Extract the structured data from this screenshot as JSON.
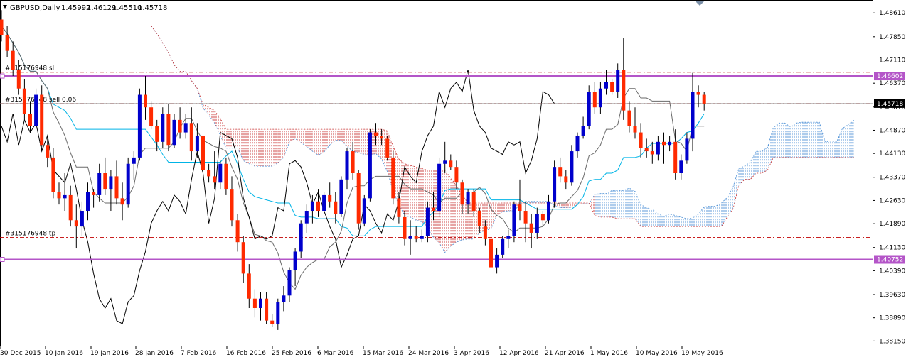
{
  "header": {
    "symbol": "GBPUSD,Daily",
    "open": "1.45992",
    "high": "1.46129",
    "low": "1.45510",
    "close": "1.45718"
  },
  "colors": {
    "up": "#0000cc",
    "down": "#ff2a00",
    "wick": "#000000",
    "tenkan": "#6a6a6a",
    "kijun": "#00b4e6",
    "chikou": "#000000",
    "cloud_bear": "#c83232",
    "cloud_bull": "#4a8fd6",
    "order_line": "#c00000",
    "resistance": "#b455c8",
    "price_line": "#888888"
  },
  "orders": [
    {
      "label": "#315176948 sl",
      "price": 1.4672
    },
    {
      "label": "#315176948 sell 0.06",
      "price": 1.4572
    },
    {
      "label": "#315176948 tp",
      "price": 1.4145
    }
  ],
  "badges": [
    {
      "text": "1.46602",
      "price": 1.466,
      "style": "purple"
    },
    {
      "text": "1.45718",
      "price": 1.4572,
      "style": "black"
    },
    {
      "text": "1.40752",
      "price": 1.4075,
      "style": "purple"
    }
  ],
  "chart_data": {
    "type": "candlestick",
    "ylim": [
      1.38,
      1.49
    ],
    "y_ticks": [
      "1.48610",
      "1.47850",
      "1.47110",
      "1.46370",
      "1.45610",
      "1.44870",
      "1.44130",
      "1.43370",
      "1.42630",
      "1.41890",
      "1.41130",
      "1.40390",
      "1.39630",
      "1.38890",
      "1.38150"
    ],
    "x_labels": [
      "30 Dec 2015",
      "10 Jan 2016",
      "19 Jan 2016",
      "28 Jan 2016",
      "7 Feb 2016",
      "16 Feb 2016",
      "25 Feb 2016",
      "6 Mar 2016",
      "15 Mar 2016",
      "24 Mar 2016",
      "3 Apr 2016",
      "12 Apr 2016",
      "21 Apr 2016",
      "1 May 2016",
      "10 May 2016",
      "19 May 2016"
    ],
    "candles": [
      [
        1.484,
        1.487,
        1.477,
        1.479
      ],
      [
        1.479,
        1.482,
        1.472,
        1.474
      ],
      [
        1.474,
        1.477,
        1.466,
        1.468
      ],
      [
        1.468,
        1.471,
        1.46,
        1.462
      ],
      [
        1.462,
        1.465,
        1.452,
        1.454
      ],
      [
        1.454,
        1.458,
        1.448,
        1.45
      ],
      [
        1.45,
        1.462,
        1.449,
        1.46
      ],
      [
        1.46,
        1.463,
        1.442,
        1.444
      ],
      [
        1.444,
        1.447,
        1.437,
        1.44
      ],
      [
        1.44,
        1.443,
        1.427,
        1.429
      ],
      [
        1.429,
        1.432,
        1.425,
        1.427
      ],
      [
        1.427,
        1.435,
        1.423,
        1.428
      ],
      [
        1.428,
        1.431,
        1.418,
        1.42
      ],
      [
        1.42,
        1.425,
        1.411,
        1.418
      ],
      [
        1.418,
        1.426,
        1.415,
        1.423
      ],
      [
        1.423,
        1.432,
        1.42,
        1.429
      ],
      [
        1.429,
        1.43,
        1.424,
        1.428
      ],
      [
        1.428,
        1.438,
        1.426,
        1.435
      ],
      [
        1.435,
        1.44,
        1.428,
        1.43
      ],
      [
        1.43,
        1.436,
        1.423,
        1.434
      ],
      [
        1.434,
        1.439,
        1.425,
        1.427
      ],
      [
        1.427,
        1.432,
        1.42,
        1.425
      ],
      [
        1.425,
        1.44,
        1.424,
        1.438
      ],
      [
        1.438,
        1.442,
        1.433,
        1.44
      ],
      [
        1.44,
        1.462,
        1.439,
        1.46
      ],
      [
        1.46,
        1.466,
        1.452,
        1.456
      ],
      [
        1.456,
        1.458,
        1.449,
        1.45
      ],
      [
        1.45,
        1.452,
        1.442,
        1.445
      ],
      [
        1.445,
        1.456,
        1.443,
        1.454
      ],
      [
        1.454,
        1.457,
        1.442,
        1.444
      ],
      [
        1.444,
        1.454,
        1.443,
        1.452
      ],
      [
        1.452,
        1.456,
        1.446,
        1.448
      ],
      [
        1.448,
        1.454,
        1.446,
        1.451
      ],
      [
        1.451,
        1.456,
        1.439,
        1.442
      ],
      [
        1.442,
        1.451,
        1.44,
        1.447
      ],
      [
        1.447,
        1.45,
        1.434,
        1.436
      ],
      [
        1.436,
        1.438,
        1.432,
        1.434
      ],
      [
        1.434,
        1.442,
        1.43,
        1.432
      ],
      [
        1.432,
        1.439,
        1.43,
        1.438
      ],
      [
        1.438,
        1.44,
        1.428,
        1.43
      ],
      [
        1.43,
        1.434,
        1.418,
        1.42
      ],
      [
        1.42,
        1.422,
        1.41,
        1.413
      ],
      [
        1.413,
        1.415,
        1.4,
        1.403
      ],
      [
        1.403,
        1.406,
        1.392,
        1.395
      ],
      [
        1.395,
        1.398,
        1.389,
        1.392
      ],
      [
        1.392,
        1.397,
        1.388,
        1.395
      ],
      [
        1.395,
        1.397,
        1.387,
        1.388
      ],
      [
        1.388,
        1.39,
        1.386,
        1.387
      ],
      [
        1.387,
        1.395,
        1.385,
        1.394
      ],
      [
        1.394,
        1.399,
        1.391,
        1.396
      ],
      [
        1.396,
        1.405,
        1.394,
        1.404
      ],
      [
        1.404,
        1.411,
        1.399,
        1.41
      ],
      [
        1.41,
        1.42,
        1.408,
        1.419
      ],
      [
        1.419,
        1.425,
        1.416,
        1.423
      ],
      [
        1.423,
        1.428,
        1.419,
        1.426
      ],
      [
        1.426,
        1.43,
        1.421,
        1.423
      ],
      [
        1.423,
        1.429,
        1.422,
        1.428
      ],
      [
        1.428,
        1.432,
        1.424,
        1.426
      ],
      [
        1.426,
        1.429,
        1.419,
        1.422
      ],
      [
        1.422,
        1.434,
        1.421,
        1.433
      ],
      [
        1.433,
        1.443,
        1.43,
        1.442
      ],
      [
        1.442,
        1.445,
        1.433,
        1.435
      ],
      [
        1.435,
        1.436,
        1.417,
        1.419
      ],
      [
        1.419,
        1.428,
        1.418,
        1.427
      ],
      [
        1.427,
        1.449,
        1.426,
        1.448
      ],
      [
        1.448,
        1.451,
        1.444,
        1.447
      ],
      [
        1.447,
        1.449,
        1.444,
        1.446
      ],
      [
        1.446,
        1.447,
        1.439,
        1.44
      ],
      [
        1.44,
        1.442,
        1.425,
        1.427
      ],
      [
        1.427,
        1.429,
        1.419,
        1.421
      ],
      [
        1.421,
        1.423,
        1.412,
        1.414
      ],
      [
        1.414,
        1.42,
        1.409,
        1.415
      ],
      [
        1.415,
        1.418,
        1.413,
        1.414
      ],
      [
        1.414,
        1.417,
        1.413,
        1.415
      ],
      [
        1.415,
        1.426,
        1.413,
        1.424
      ],
      [
        1.424,
        1.429,
        1.42,
        1.423
      ],
      [
        1.423,
        1.44,
        1.421,
        1.438
      ],
      [
        1.438,
        1.445,
        1.435,
        1.439
      ],
      [
        1.439,
        1.441,
        1.436,
        1.437
      ],
      [
        1.437,
        1.439,
        1.43,
        1.432
      ],
      [
        1.432,
        1.433,
        1.422,
        1.425
      ],
      [
        1.425,
        1.43,
        1.422,
        1.429
      ],
      [
        1.429,
        1.43,
        1.421,
        1.423
      ],
      [
        1.423,
        1.424,
        1.416,
        1.418
      ],
      [
        1.418,
        1.42,
        1.412,
        1.414
      ],
      [
        1.414,
        1.416,
        1.402,
        1.405
      ],
      [
        1.405,
        1.411,
        1.403,
        1.409
      ],
      [
        1.409,
        1.415,
        1.408,
        1.414
      ],
      [
        1.414,
        1.417,
        1.411,
        1.415
      ],
      [
        1.415,
        1.426,
        1.413,
        1.425
      ],
      [
        1.425,
        1.433,
        1.42,
        1.423
      ],
      [
        1.423,
        1.426,
        1.413,
        1.419
      ],
      [
        1.419,
        1.422,
        1.411,
        1.416
      ],
      [
        1.416,
        1.424,
        1.414,
        1.422
      ],
      [
        1.422,
        1.423,
        1.418,
        1.42
      ],
      [
        1.42,
        1.428,
        1.419,
        1.426
      ],
      [
        1.426,
        1.439,
        1.424,
        1.437
      ],
      [
        1.437,
        1.44,
        1.432,
        1.434
      ],
      [
        1.434,
        1.436,
        1.43,
        1.432
      ],
      [
        1.432,
        1.444,
        1.431,
        1.442
      ],
      [
        1.442,
        1.448,
        1.44,
        1.447
      ],
      [
        1.447,
        1.453,
        1.446,
        1.45
      ],
      [
        1.45,
        1.463,
        1.449,
        1.461
      ],
      [
        1.461,
        1.464,
        1.454,
        1.456
      ],
      [
        1.456,
        1.464,
        1.454,
        1.462
      ],
      [
        1.462,
        1.468,
        1.46,
        1.464
      ],
      [
        1.464,
        1.465,
        1.46,
        1.461
      ],
      [
        1.461,
        1.47,
        1.459,
        1.468
      ],
      [
        1.468,
        1.478,
        1.452,
        1.455
      ],
      [
        1.455,
        1.458,
        1.448,
        1.45
      ],
      [
        1.45,
        1.456,
        1.446,
        1.448
      ],
      [
        1.448,
        1.451,
        1.44,
        1.443
      ],
      [
        1.443,
        1.446,
        1.44,
        1.442
      ],
      [
        1.442,
        1.445,
        1.438,
        1.441
      ],
      [
        1.441,
        1.447,
        1.439,
        1.445
      ],
      [
        1.445,
        1.448,
        1.438,
        1.444
      ],
      [
        1.444,
        1.447,
        1.442,
        1.445
      ],
      [
        1.445,
        1.449,
        1.433,
        1.435
      ],
      [
        1.435,
        1.441,
        1.433,
        1.439
      ],
      [
        1.439,
        1.448,
        1.438,
        1.446
      ],
      [
        1.446,
        1.467,
        1.442,
        1.461
      ],
      [
        1.461,
        1.463,
        1.456,
        1.46
      ],
      [
        1.46,
        1.461,
        1.455,
        1.4572
      ]
    ]
  }
}
